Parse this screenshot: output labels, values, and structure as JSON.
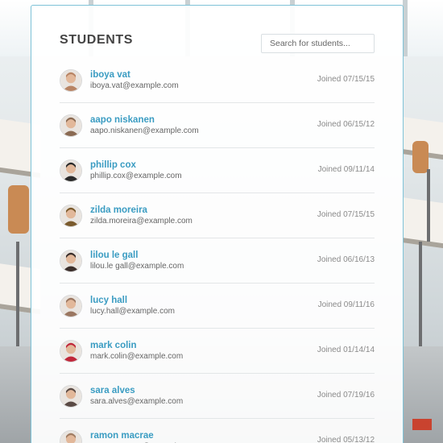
{
  "header": {
    "title": "STUDENTS",
    "search_placeholder": "Search for students..."
  },
  "students": [
    {
      "name": "iboya vat",
      "email": "iboya.vat@example.com",
      "joined": "Joined 07/15/15",
      "avatar_color": "#b88464"
    },
    {
      "name": "aapo niskanen",
      "email": "aapo.niskanen@example.com",
      "joined": "Joined 06/15/12",
      "avatar_color": "#8a6a52"
    },
    {
      "name": "phillip cox",
      "email": "phillip.cox@example.com",
      "joined": "Joined 09/11/14",
      "avatar_color": "#2a2a2a"
    },
    {
      "name": "zilda moreira",
      "email": "zilda.moreira@example.com",
      "joined": "Joined 07/15/15",
      "avatar_color": "#7a5a2c"
    },
    {
      "name": "lilou le gall",
      "email": "lilou.le gall@example.com",
      "joined": "Joined 06/16/13",
      "avatar_color": "#3a2e2a"
    },
    {
      "name": "lucy hall",
      "email": "lucy.hall@example.com",
      "joined": "Joined 09/11/16",
      "avatar_color": "#9a7660"
    },
    {
      "name": "mark colin",
      "email": "mark.colin@example.com",
      "joined": "Joined 01/14/14",
      "avatar_color": "#c0273a"
    },
    {
      "name": "sara alves",
      "email": "sara.alves@example.com",
      "joined": "Joined 07/19/16",
      "avatar_color": "#5a4a44"
    },
    {
      "name": "ramon macrae",
      "email": "ramon.macrae@example.com",
      "joined": "Joined 05/13/12",
      "avatar_color": "#a07c62"
    }
  ]
}
